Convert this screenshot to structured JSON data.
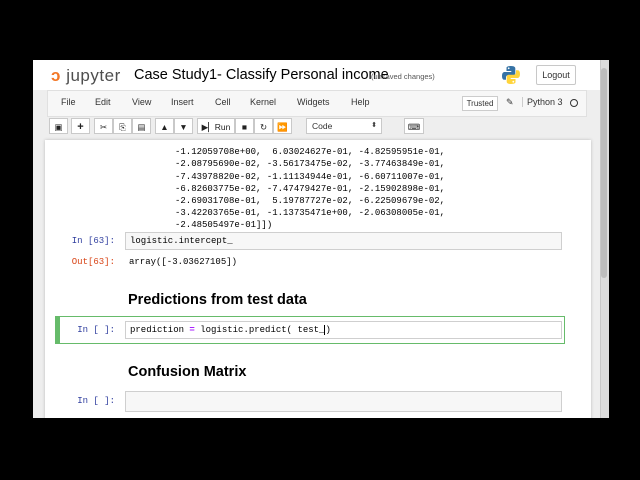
{
  "header": {
    "logo_text": "jupyter",
    "notebook_title": "Case Study1- Classify Personal income",
    "save_status": "(unsaved changes)",
    "logout_label": "Logout"
  },
  "menu": {
    "items": [
      "File",
      "Edit",
      "View",
      "Insert",
      "Cell",
      "Kernel",
      "Widgets",
      "Help"
    ],
    "trusted_label": "Trusted",
    "kernel_name": "Python 3"
  },
  "toolbar": {
    "run_label": "Run",
    "cell_type": "Code"
  },
  "cells": {
    "array_output_lines": [
      "-1.12059708e+00,  6.03024627e-01, -4.82595951e-01,",
      "-2.08795690e-02, -3.56173475e-02, -3.77463849e-01,",
      "-7.43978820e-02, -1.11134944e-01, -6.60711007e-01,",
      "-6.82603775e-02, -7.47479427e-01, -2.15902898e-01,",
      "-2.69031708e-01,  5.19787727e-02, -6.22509679e-02,",
      "-3.42203765e-01, -1.13735471e+00, -2.06308005e-01,",
      "-2.48505497e-01]])"
    ],
    "intercept_prompt": "In [63]:",
    "intercept_code": "logistic.intercept_",
    "intercept_out_prompt": "Out[63]:",
    "intercept_output": "array([-3.03627105])",
    "heading_predictions": "Predictions from test data",
    "prediction_prompt": "In [ ]:",
    "prediction_code_var": "prediction",
    "prediction_code_op": "=",
    "prediction_code_rest": "logistic.predict( test_",
    "prediction_code_close": ")",
    "heading_confusion": "Confusion Matrix",
    "confusion_prompt": "In [ ]:"
  },
  "colors": {
    "jupyter_orange": "#f37726",
    "in_prompt": "#303f9f",
    "out_prompt": "#d84315",
    "selected_cell": "#66bb6a"
  }
}
